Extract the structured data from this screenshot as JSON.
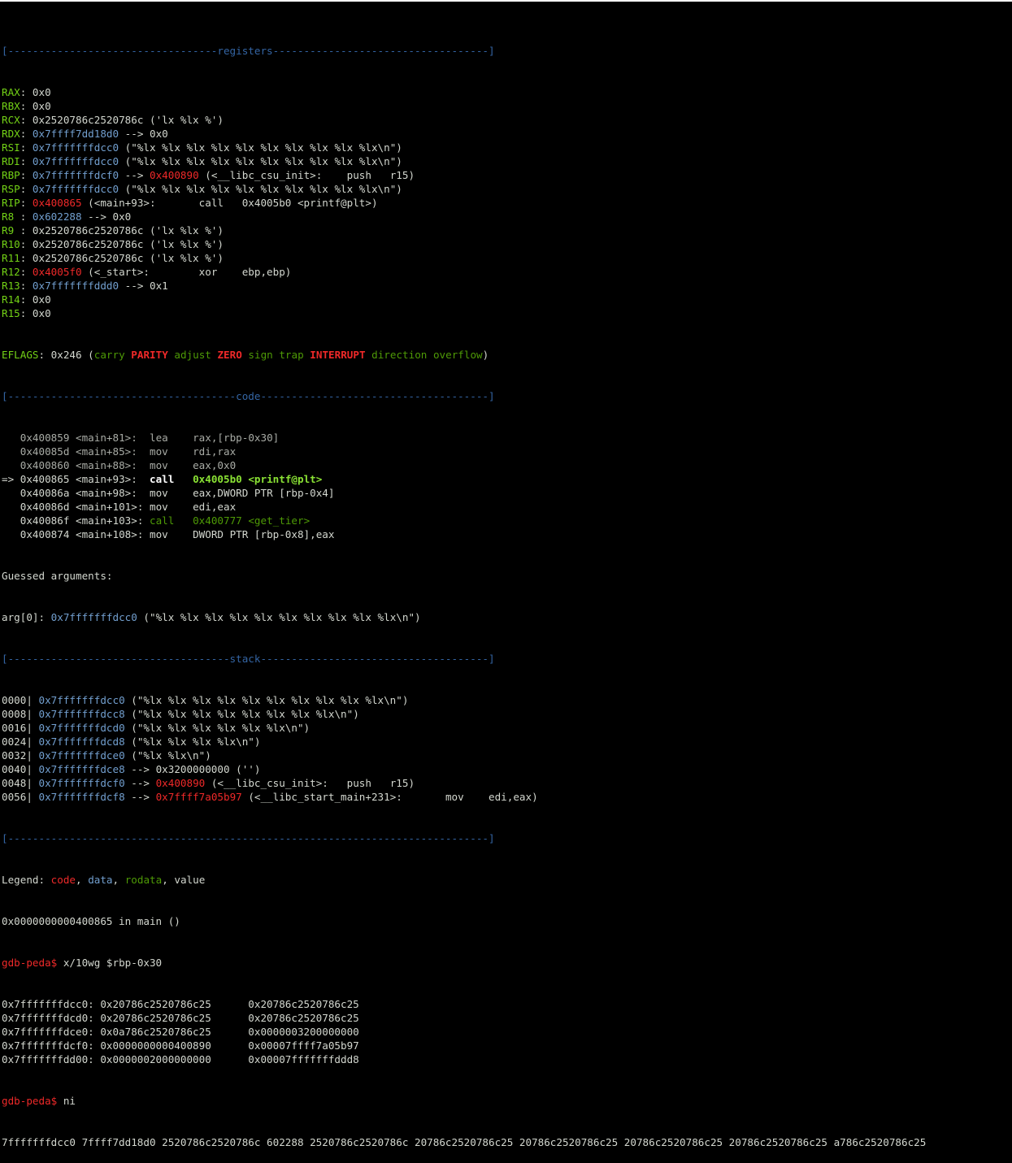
{
  "terminal": {
    "sep_registers": "[----------------------------------registers-----------------------------------]",
    "registers": [
      {
        "name": "RAX",
        "rest": "0x0"
      },
      {
        "name": "RBX",
        "rest": "0x0"
      },
      {
        "name": "RCX",
        "rest": "0x2520786c2520786c ('lx %lx %')"
      },
      {
        "name": "RDX",
        "addr": "0x7ffff7dd18d0",
        "rest": " --> 0x0"
      },
      {
        "name": "RSI",
        "addr": "0x7fffffffdcc0",
        "rest": " (\"%lx %lx %lx %lx %lx %lx %lx %lx %lx %lx\\n\")"
      },
      {
        "name": "RDI",
        "addr": "0x7fffffffdcc0",
        "rest": " (\"%lx %lx %lx %lx %lx %lx %lx %lx %lx %lx\\n\")"
      },
      {
        "name": "RBP",
        "addr": "0x7fffffffdcf0",
        "mid": " --> ",
        "code": "0x400890",
        "rest": " (<__libc_csu_init>:    push   r15)"
      },
      {
        "name": "RSP",
        "addr": "0x7fffffffdcc0",
        "rest": " (\"%lx %lx %lx %lx %lx %lx %lx %lx %lx %lx\\n\")"
      },
      {
        "name": "RIP",
        "code": "0x400865",
        "rest": " (<main+93>:       call   0x4005b0 <printf@plt>)"
      },
      {
        "name": "R8 ",
        "addr": "0x602288",
        "rest": " --> 0x0"
      },
      {
        "name": "R9 ",
        "rest": "0x2520786c2520786c ('lx %lx %')"
      },
      {
        "name": "R10",
        "rest": "0x2520786c2520786c ('lx %lx %')"
      },
      {
        "name": "R11",
        "rest": "0x2520786c2520786c ('lx %lx %')"
      },
      {
        "name": "R12",
        "code": "0x4005f0",
        "rest": " (<_start>:        xor    ebp,ebp)"
      },
      {
        "name": "R13",
        "addr": "0x7fffffffddd0",
        "rest": " --> 0x1"
      },
      {
        "name": "R14",
        "rest": "0x0"
      },
      {
        "name": "R15",
        "rest": "0x0"
      }
    ],
    "eflags": {
      "label": "EFLAGS",
      "value": "0x246",
      "open": " (",
      "carry": "carry",
      "parity": "PARITY",
      "adjust": "adjust",
      "zero": "ZERO",
      "sign": "sign",
      "trap": "trap",
      "interrupt": "INTERRUPT",
      "direction": "direction",
      "overflow": "overflow",
      "close": ")"
    },
    "sep_code": "[-------------------------------------code-------------------------------------]",
    "code": [
      {
        "prefix": "   ",
        "addr": "0x400859",
        "sym": " <main+81>:  ",
        "mnem": "lea",
        "ops": "    rax,[rbp-0x30]",
        "type": "dim"
      },
      {
        "prefix": "   ",
        "addr": "0x40085d",
        "sym": " <main+85>:  ",
        "mnem": "mov",
        "ops": "    rdi,rax",
        "type": "dim"
      },
      {
        "prefix": "   ",
        "addr": "0x400860",
        "sym": " <main+88>:  ",
        "mnem": "mov",
        "ops": "    eax,0x0",
        "type": "dim"
      },
      {
        "prefix": "=> ",
        "addr": "0x400865",
        "sym": " <main+93>:  ",
        "mnem": "call",
        "ops": "   0x4005b0 <printf@plt>",
        "type": "current"
      },
      {
        "prefix": "   ",
        "addr": "0x40086a",
        "sym": " <main+98>:  ",
        "mnem": "mov",
        "ops": "    eax,DWORD PTR [rbp-0x4]",
        "type": "normal"
      },
      {
        "prefix": "   ",
        "addr": "0x40086d",
        "sym": " <main+101>: ",
        "mnem": "mov",
        "ops": "    edi,eax",
        "type": "normal"
      },
      {
        "prefix": "   ",
        "addr": "0x40086f",
        "sym": " <main+103>: ",
        "mnem": "call",
        "ops": "   0x400777 <get_tier>",
        "type": "call"
      },
      {
        "prefix": "   ",
        "addr": "0x400874",
        "sym": " <main+108>: ",
        "mnem": "mov",
        "ops": "    DWORD PTR [rbp-0x8],eax",
        "type": "normal"
      }
    ],
    "guessed": "Guessed arguments:",
    "arg0": {
      "label": "arg[0]: ",
      "addr": "0x7fffffffdcc0",
      "rest": " (\"%lx %lx %lx %lx %lx %lx %lx %lx %lx %lx\\n\")"
    },
    "sep_stack": "[------------------------------------stack-------------------------------------]",
    "stack": [
      {
        "off": "0000| ",
        "addr": "0x7fffffffdcc0",
        "rest": " (\"%lx %lx %lx %lx %lx %lx %lx %lx %lx %lx\\n\")"
      },
      {
        "off": "0008| ",
        "addr": "0x7fffffffdcc8",
        "rest": " (\"%lx %lx %lx %lx %lx %lx %lx %lx\\n\")"
      },
      {
        "off": "0016| ",
        "addr": "0x7fffffffdcd0",
        "rest": " (\"%lx %lx %lx %lx %lx %lx\\n\")"
      },
      {
        "off": "0024| ",
        "addr": "0x7fffffffdcd8",
        "rest": " (\"%lx %lx %lx %lx\\n\")"
      },
      {
        "off": "0032| ",
        "addr": "0x7fffffffdce0",
        "rest": " (\"%lx %lx\\n\")"
      },
      {
        "off": "0040| ",
        "addr": "0x7fffffffdce8",
        "rest": " --> 0x3200000000 ('')"
      },
      {
        "off": "0048| ",
        "addr": "0x7fffffffdcf0",
        "mid": " --> ",
        "code": "0x400890",
        "rest": " (<__libc_csu_init>:   push   r15)"
      },
      {
        "off": "0056| ",
        "addr": "0x7fffffffdcf8",
        "mid": " --> ",
        "code": "0x7ffff7a05b97",
        "rest": " (<__libc_start_main+231>:       mov    edi,eax)"
      }
    ],
    "sep_end": "[------------------------------------------------------------------------------]",
    "legend": {
      "label": "Legend: ",
      "code": "code",
      "sep1": ", ",
      "data": "data",
      "sep2": ", ",
      "rodata": "rodata",
      "sep3": ", ",
      "value": "value"
    },
    "location": "0x0000000000400865 in main ()",
    "prompt1": {
      "prompt": "gdb-peda$ ",
      "cmd": "x/10wg $rbp-0x30"
    },
    "dump": [
      "0x7fffffffdcc0: 0x20786c2520786c25      0x20786c2520786c25",
      "0x7fffffffdcd0: 0x20786c2520786c25      0x20786c2520786c25",
      "0x7fffffffdce0: 0x0a786c2520786c25      0x0000003200000000",
      "0x7fffffffdcf0: 0x0000000000400890      0x00007ffff7a05b97",
      "0x7fffffffdd00: 0x0000002000000000      0x00007fffffffddd8"
    ],
    "prompt2": {
      "prompt": "gdb-peda$ ",
      "cmd": "ni"
    },
    "output": "7fffffffdcc0 7ffff7dd18d0 2520786c2520786c 602288 2520786c2520786c 20786c2520786c25 20786c2520786c25 20786c2520786c25 20786c2520786c25 a786c2520786c25"
  }
}
